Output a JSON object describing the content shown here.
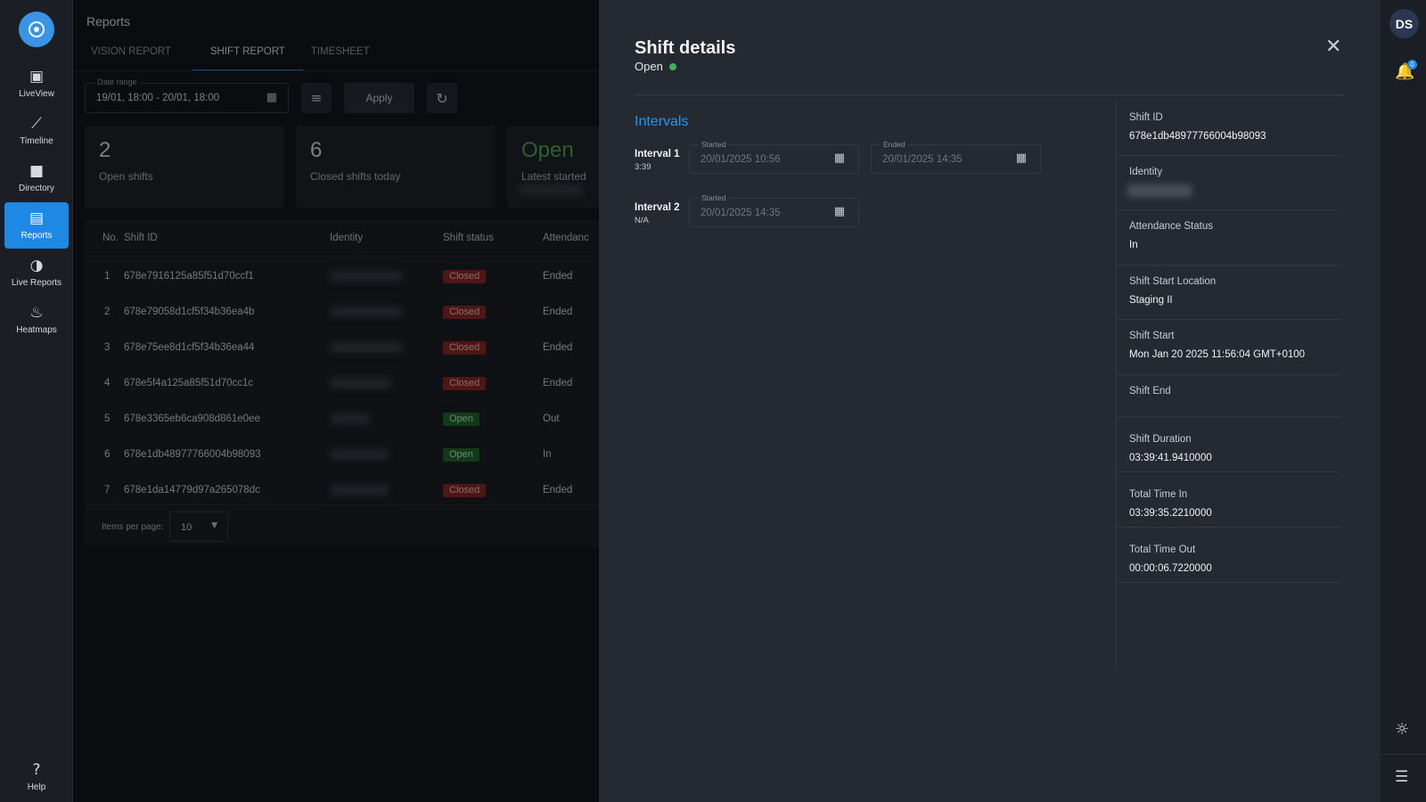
{
  "nav": {
    "items": [
      {
        "icon": "live-view-icon",
        "glyph": "▣",
        "label": "LiveView"
      },
      {
        "icon": "timeline-icon",
        "glyph": "⟋",
        "label": "Timeline"
      },
      {
        "icon": "folder-icon",
        "glyph": "■",
        "label": "Directory"
      },
      {
        "icon": "document-icon",
        "glyph": "▤",
        "label": "Reports"
      },
      {
        "icon": "live-reports-icon",
        "glyph": "◑",
        "label": "Live Reports"
      },
      {
        "icon": "heatmap-icon",
        "glyph": "♨",
        "label": "Heatmaps"
      }
    ],
    "help_label": "Help",
    "help_glyph": "?"
  },
  "rail": {
    "avatar": "DS",
    "bell_glyph": "🔔",
    "bell_count": "0",
    "sun_glyph": "☼",
    "tune_glyph": "☰"
  },
  "reports": {
    "title": "Reports",
    "tabs": [
      "VISION REPORT",
      "SHIFT REPORT",
      "TIMESHEET"
    ],
    "date_range_label": "Date range",
    "date_range_value": "19/01, 18:00 - 20/01, 18:00",
    "apply_label": "Apply",
    "stats": [
      {
        "value": "2",
        "caption": "Open shifts"
      },
      {
        "value": "6",
        "caption": "Closed shifts today"
      },
      {
        "value": "Open",
        "caption": "Latest started"
      }
    ],
    "columns": [
      "No.",
      "Shift ID",
      "Identity",
      "Shift status",
      "Attendanc"
    ],
    "rows": [
      {
        "no": "1",
        "id": "678e7916125a85f51d70ccf1",
        "status": "Closed",
        "attendance": "Ended"
      },
      {
        "no": "2",
        "id": "678e79058d1cf5f34b36ea4b",
        "status": "Closed",
        "attendance": "Ended"
      },
      {
        "no": "3",
        "id": "678e75ee8d1cf5f34b36ea44",
        "status": "Closed",
        "attendance": "Ended"
      },
      {
        "no": "4",
        "id": "678e5f4a125a85f51d70cc1c",
        "status": "Closed",
        "attendance": "Ended"
      },
      {
        "no": "5",
        "id": "678e3365eb6ca908d861e0ee",
        "status": "Open",
        "attendance": "Out"
      },
      {
        "no": "6",
        "id": "678e1db48977766004b98093",
        "status": "Open",
        "attendance": "In"
      },
      {
        "no": "7",
        "id": "678e1da14779d97a265078dc",
        "status": "Closed",
        "attendance": "Ended"
      }
    ],
    "items_per_page_label": "Items per page:",
    "items_per_page_value": "10"
  },
  "drawer": {
    "title": "Shift details",
    "status": "Open",
    "intervals_title": "Intervals",
    "intervals": [
      {
        "name": "Interval 1",
        "duration": "3:39",
        "started_label": "Started",
        "started": "20/01/2025 10:56",
        "ended_label": "Ended",
        "ended": "20/01/2025 14:35"
      },
      {
        "name": "Interval 2",
        "duration": "N/A",
        "started_label": "Started",
        "started": "20/01/2025 14:35"
      }
    ],
    "details": {
      "shift_id": {
        "label": "Shift ID",
        "value": "678e1db48977766004b98093"
      },
      "identity": {
        "label": "Identity"
      },
      "attendance_status": {
        "label": "Attendance Status",
        "value": "In"
      },
      "shift_start_location": {
        "label": "Shift Start Location",
        "value": "Staging II"
      },
      "shift_start": {
        "label": "Shift Start",
        "value": "Mon Jan 20 2025 11:56:04 GMT+0100"
      },
      "shift_end": {
        "label": "Shift End"
      },
      "shift_duration": {
        "label": "Shift Duration",
        "value": "03:39:41.9410000"
      },
      "total_time_in": {
        "label": "Total Time In",
        "value": "03:39:35.2210000"
      },
      "total_time_out": {
        "label": "Total Time Out",
        "value": "00:00:06.7220000"
      }
    }
  },
  "colors": {
    "accent": "#1e88e5",
    "closed_badge": "#8f2826",
    "open_badge": "#1f6b2e",
    "open_dot": "#43b05c"
  }
}
